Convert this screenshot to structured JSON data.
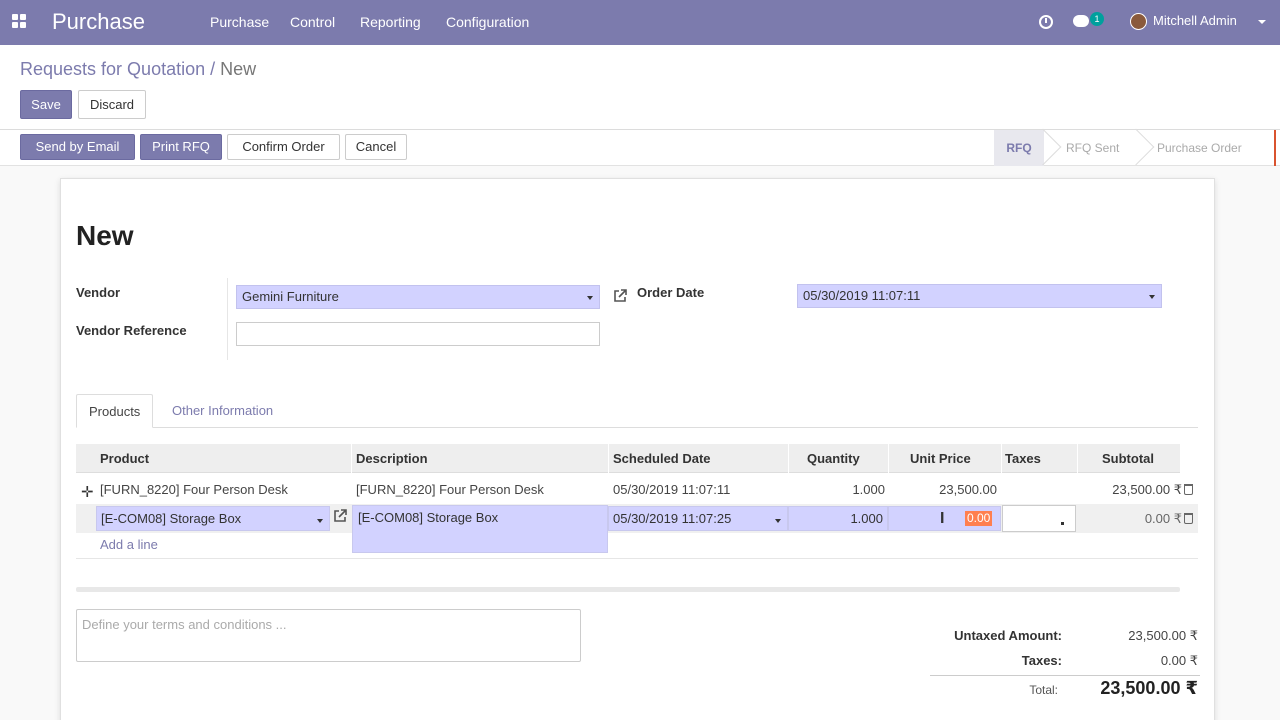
{
  "navbar": {
    "app_title": "Purchase",
    "menu": [
      "Purchase",
      "Control",
      "Reporting",
      "Configuration"
    ],
    "chat_count": "1",
    "user_name": "Mitchell Admin"
  },
  "breadcrumb": {
    "parent": "Requests for Quotation",
    "separator": "/",
    "current": "New"
  },
  "toolbar": {
    "save_label": "Save",
    "discard_label": "Discard"
  },
  "statusbar": {
    "actions": [
      "Send by Email",
      "Print RFQ",
      "Confirm Order",
      "Cancel"
    ],
    "stages": [
      "RFQ",
      "RFQ Sent",
      "Purchase Order"
    ],
    "active_stage": "RFQ"
  },
  "form": {
    "title": "New",
    "vendor_label": "Vendor",
    "vendor_value": "Gemini Furniture",
    "vendor_ref_label": "Vendor Reference",
    "vendor_ref_value": "",
    "order_date_label": "Order Date",
    "order_date_value": "05/30/2019 11:07:11"
  },
  "tabs": [
    "Products",
    "Other Information"
  ],
  "lines": {
    "columns": [
      "Product",
      "Description",
      "Scheduled Date",
      "Quantity",
      "Unit Price",
      "Taxes",
      "Subtotal"
    ],
    "rows": [
      {
        "product": "[FURN_8220] Four Person Desk",
        "description": "[FURN_8220] Four Person Desk",
        "scheduled_date": "05/30/2019 11:07:11",
        "quantity": "1.000",
        "unit_price": "23,500.00",
        "taxes": "",
        "subtotal": "23,500.00 ₹"
      },
      {
        "product": "[E-COM08] Storage Box",
        "description": "[E-COM08] Storage Box",
        "scheduled_date": "05/30/2019 11:07:25",
        "quantity": "1.000",
        "unit_price": "0.00",
        "taxes": "",
        "subtotal": "0.00 ₹"
      }
    ],
    "add_line": "Add a line"
  },
  "notes": {
    "placeholder": "Define your terms and conditions ..."
  },
  "totals": {
    "untaxed_label": "Untaxed Amount:",
    "untaxed_value": "23,500.00 ₹",
    "taxes_label": "Taxes:",
    "taxes_value": "0.00 ₹",
    "total_label": "Total:",
    "total_value": "23,500.00 ₹"
  },
  "colors": {
    "brand": "#7c7bad",
    "required_field": "#d2d2ff",
    "highlight": "#ff7f50"
  },
  "icons": [
    "apps-grid-icon",
    "clock-icon",
    "chat-icon",
    "user-avatar",
    "external-link-icon",
    "plus-icon",
    "trash-icon",
    "text-cursor-icon"
  ]
}
